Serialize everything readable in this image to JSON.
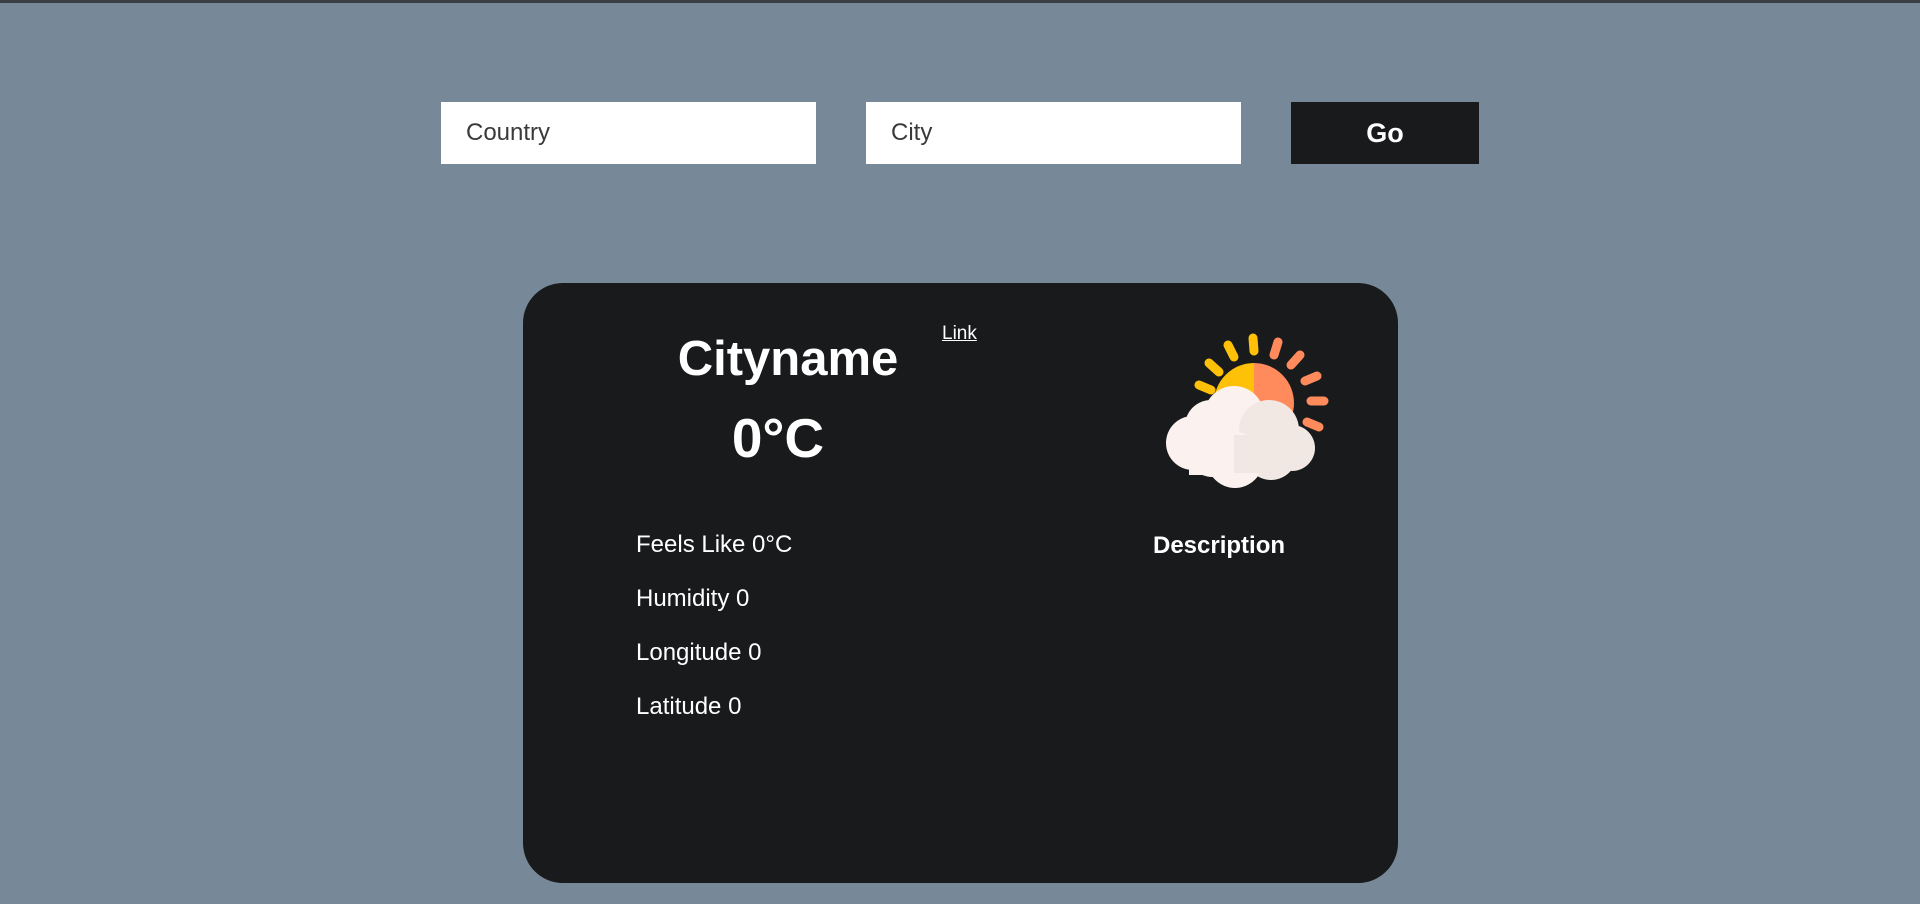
{
  "search": {
    "country_placeholder": "Country",
    "city_placeholder": "City",
    "go_label": "Go"
  },
  "card": {
    "city_name": "Cityname",
    "temperature": "0°C",
    "link_label": "Link",
    "feels_like": "Feels Like 0°C",
    "humidity": "Humidity 0",
    "longitude": "Longitude 0",
    "latitude": "Latitude 0",
    "description": "Description",
    "icon": "partly-cloudy-icon"
  },
  "colors": {
    "page_background": "#778899",
    "card_background": "#181a1c",
    "button_background": "#181a1b",
    "sun_yellow": "#ffc107",
    "sun_orange": "#ff8a5b",
    "cloud_white": "#fbf1ef"
  }
}
